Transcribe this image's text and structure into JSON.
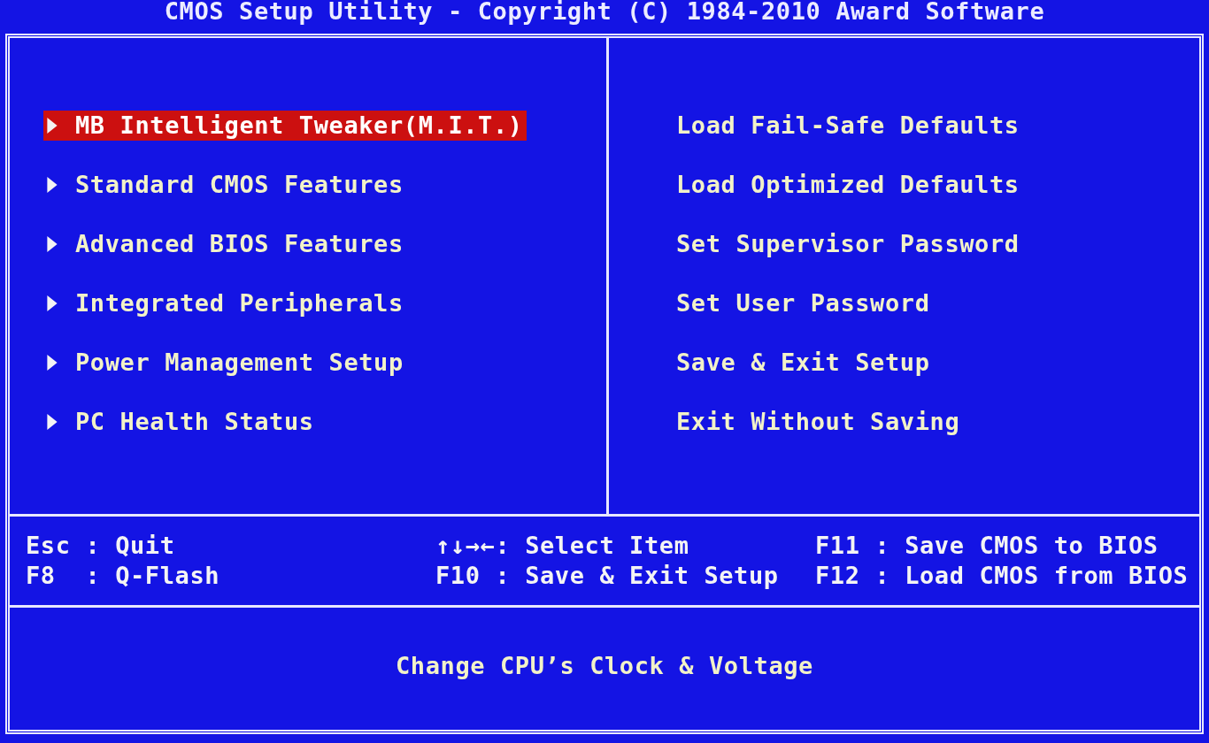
{
  "title": "CMOS Setup Utility - Copyright (C) 1984-2010 Award Software",
  "left_menu": [
    {
      "label": "MB Intelligent Tweaker(M.I.T.)",
      "selected": true
    },
    {
      "label": "Standard CMOS Features",
      "selected": false
    },
    {
      "label": "Advanced BIOS Features",
      "selected": false
    },
    {
      "label": "Integrated Peripherals",
      "selected": false
    },
    {
      "label": "Power Management Setup",
      "selected": false
    },
    {
      "label": "PC Health Status",
      "selected": false
    }
  ],
  "right_menu": [
    {
      "label": "Load Fail-Safe Defaults",
      "selected": false
    },
    {
      "label": "Load Optimized Defaults",
      "selected": false
    },
    {
      "label": "Set Supervisor Password",
      "selected": false
    },
    {
      "label": "Set User Password",
      "selected": false
    },
    {
      "label": "Save & Exit Setup",
      "selected": false
    },
    {
      "label": "Exit Without Saving",
      "selected": false
    }
  ],
  "key_legend": [
    "Esc : Quit",
    "↑↓→←: Select Item",
    "F11 : Save CMOS to BIOS",
    "F8  : Q-Flash",
    "F10 : Save & Exit Setup",
    "F12 : Load CMOS from BIOS"
  ],
  "help_text": "Change CPU’s Clock & Voltage"
}
